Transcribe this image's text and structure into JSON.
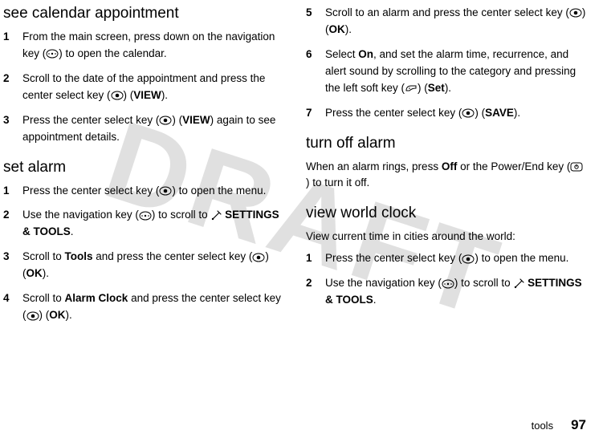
{
  "watermark": "DRAFT",
  "left": {
    "h_cal": "see calendar appointment",
    "cal_steps": [
      "From the main screen, press down on the navigation key ({NAV}) to open the calendar.",
      "Scroll to the date of the appointment and press the center select key ({SEL}) ({B:VIEW}).",
      "Press the center select key ({SEL}) ({B:VIEW}) again to see appointment details."
    ],
    "h_set": "set alarm",
    "set_steps": [
      "Press the center select key ({SEL}) to open the menu.",
      "Use the navigation key ({NAV}) to scroll to {TOOLS} {B:SETTINGS & TOOLS}.",
      "Scroll to {B:Tools} and press the center select key ({SEL}) ({B:OK}).",
      "Scroll to {B:Alarm Clock} and press the center select key ({SEL}) ({B:OK})."
    ]
  },
  "right": {
    "set_cont": [
      {
        "n": "5",
        "t": "Scroll to an alarm and press the center select key ({SEL}) ({B:OK})."
      },
      {
        "n": "6",
        "t": "Select {B:On}, and set the alarm time, recurrence, and alert sound by scrolling to the category and pressing the left soft key ({SOFT}) ({B:Set})."
      },
      {
        "n": "7",
        "t": "Press the center select key ({SEL}) ({B:SAVE})."
      }
    ],
    "h_off": "turn off alarm",
    "off_text": "When an alarm rings, press {B:Off} or the Power/End key ({END}) to turn it off.",
    "h_world": "view world clock",
    "world_intro": "View current time in cities around the world:",
    "world_steps": [
      "Press the center select key ({SEL}) to open the menu.",
      "Use the navigation key ({NAV}) to scroll to {TOOLS} {B:SETTINGS & TOOLS}."
    ]
  },
  "footer": {
    "section": "tools",
    "page": "97"
  }
}
